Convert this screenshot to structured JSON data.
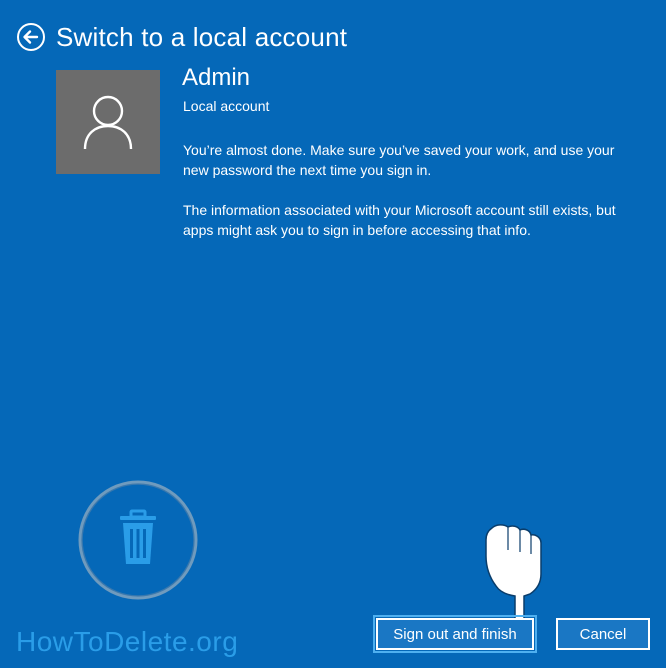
{
  "header": {
    "title": "Switch to a local account",
    "back_icon": "back-arrow-icon"
  },
  "account": {
    "name": "Admin",
    "type": "Local account",
    "avatar_icon": "user-icon"
  },
  "messages": {
    "line1": "You’re almost done. Make sure you’ve saved your work, and use your new password the next time you sign in.",
    "line2": "The information associated with your Microsoft account still exists, but apps might ask you to sign in before accessing that info."
  },
  "buttons": {
    "primary": "Sign out and finish",
    "cancel": "Cancel"
  },
  "watermark": {
    "text": "HowToDelete.org",
    "icon": "trash-icon"
  },
  "colors": {
    "background": "#0568b8",
    "avatar_bg": "#6c6c6c",
    "watermark": "#2a9de8"
  }
}
